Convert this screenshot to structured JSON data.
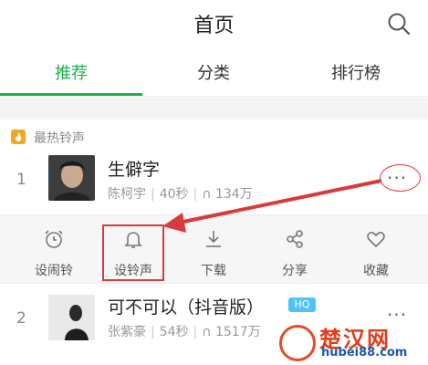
{
  "header": {
    "title": "首页",
    "search_icon": "search-icon"
  },
  "tabs": [
    {
      "label": "推荐",
      "active": true
    },
    {
      "label": "分类",
      "active": false
    },
    {
      "label": "排行榜",
      "active": false
    }
  ],
  "section": {
    "icon": "fire-icon",
    "title": "最热铃声"
  },
  "songs": [
    {
      "rank": "1",
      "title": "生僻字",
      "artist": "陈柯宇",
      "duration": "40秒",
      "plays": "134万",
      "more": "···"
    },
    {
      "rank": "2",
      "title": "可不可以（抖音版）",
      "badge": "HQ",
      "artist": "张紫豪",
      "duration": "54秒",
      "plays": "1517万",
      "more": "···"
    }
  ],
  "actions": [
    {
      "label": "设闹铃",
      "icon": "alarm-clock-icon"
    },
    {
      "label": "设铃声",
      "icon": "bell-icon"
    },
    {
      "label": "下载",
      "icon": "download-icon"
    },
    {
      "label": "分享",
      "icon": "share-icon"
    },
    {
      "label": "收藏",
      "icon": "heart-icon"
    }
  ],
  "watermark": {
    "name": "楚汉网",
    "url": "hubei88.com"
  },
  "colors": {
    "accent": "#22b04c",
    "annotation_red": "#d93a3a",
    "hq_badge": "#4ec3f7"
  }
}
